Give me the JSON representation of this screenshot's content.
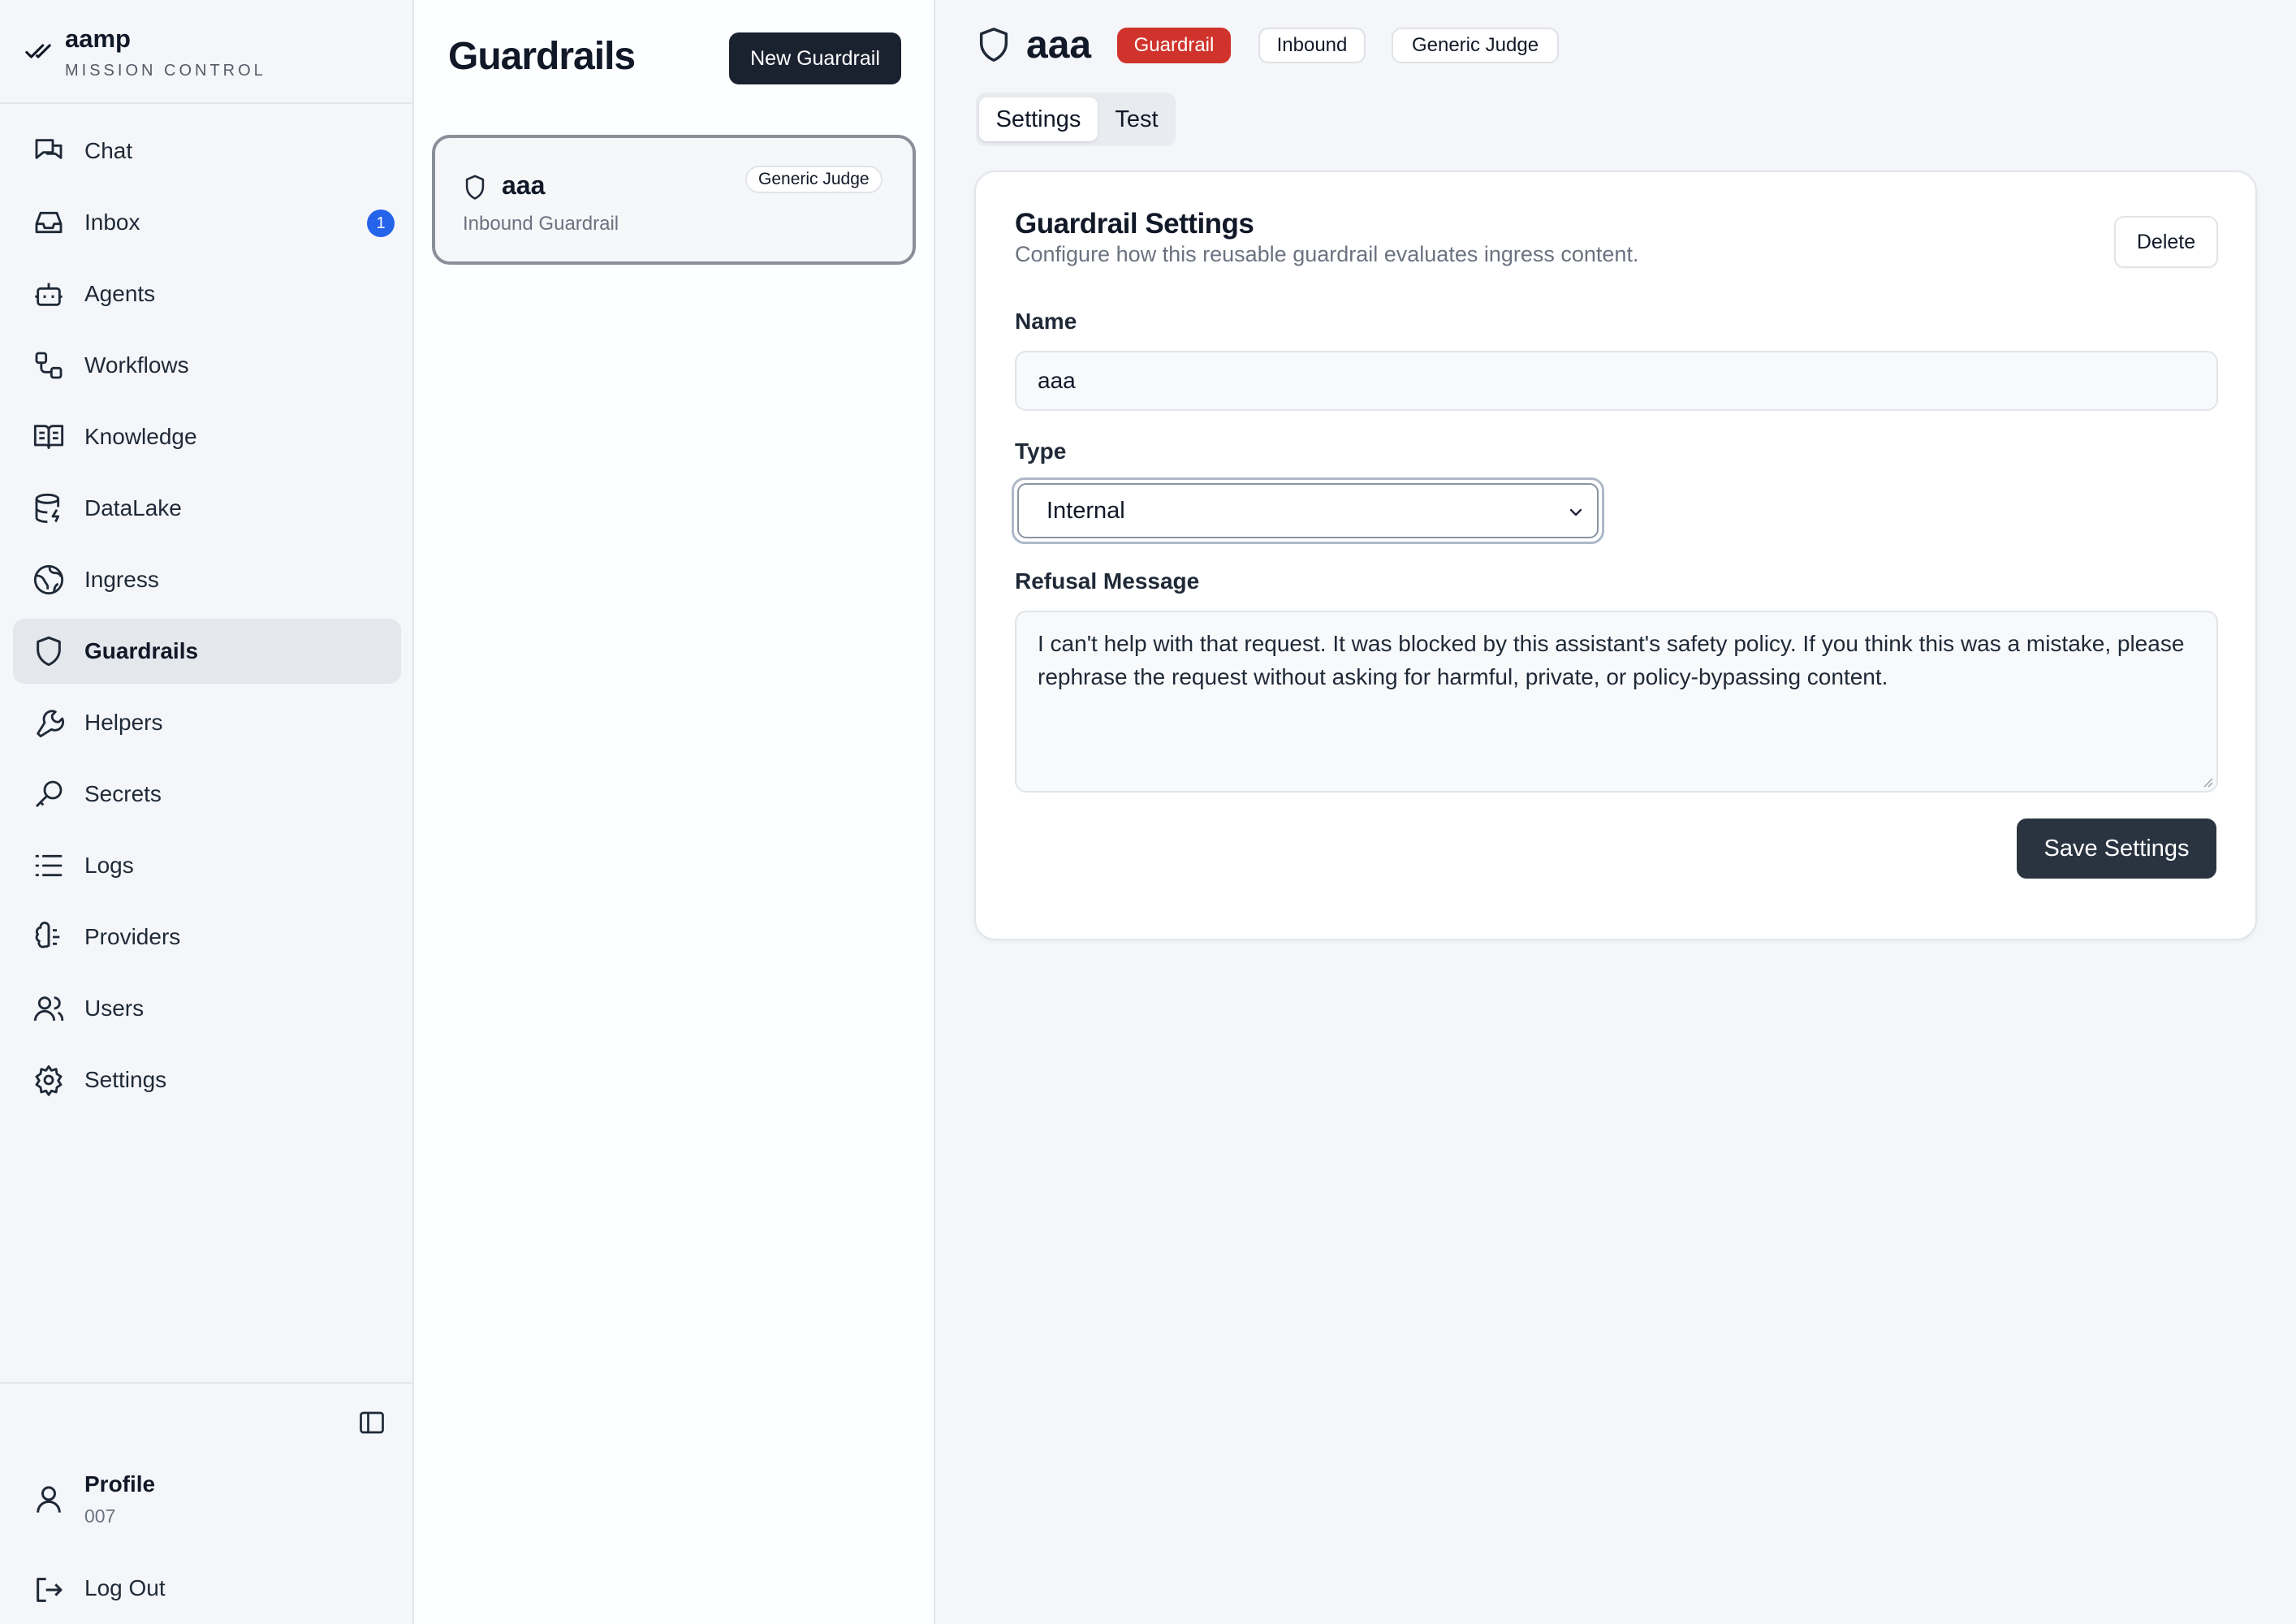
{
  "brand": {
    "name": "aamp",
    "subtitle": "MISSION CONTROL"
  },
  "sidebar": {
    "items": [
      {
        "label": "Chat",
        "icon": "chat-icon"
      },
      {
        "label": "Inbox",
        "icon": "inbox-icon",
        "badge": "1"
      },
      {
        "label": "Agents",
        "icon": "bot-icon"
      },
      {
        "label": "Workflows",
        "icon": "workflow-icon"
      },
      {
        "label": "Knowledge",
        "icon": "book-icon"
      },
      {
        "label": "DataLake",
        "icon": "database-icon"
      },
      {
        "label": "Ingress",
        "icon": "globe-icon"
      },
      {
        "label": "Guardrails",
        "icon": "shield-icon",
        "active": true
      },
      {
        "label": "Helpers",
        "icon": "wrench-icon"
      },
      {
        "label": "Secrets",
        "icon": "key-icon"
      },
      {
        "label": "Logs",
        "icon": "list-icon"
      },
      {
        "label": "Providers",
        "icon": "brain-icon"
      },
      {
        "label": "Users",
        "icon": "users-icon"
      },
      {
        "label": "Settings",
        "icon": "gear-icon"
      }
    ],
    "profile": {
      "label": "Profile",
      "id": "007"
    },
    "logout_label": "Log Out"
  },
  "list": {
    "title": "Guardrails",
    "new_button": "New Guardrail",
    "items": [
      {
        "name": "aaa",
        "subtitle": "Inbound Guardrail",
        "tag": "Generic Judge"
      }
    ]
  },
  "main": {
    "title": "aaa",
    "chips": [
      "Guardrail",
      "Inbound",
      "Generic Judge"
    ],
    "tabs": [
      "Settings",
      "Test"
    ],
    "active_tab": "Settings",
    "panel": {
      "title": "Guardrail Settings",
      "description": "Configure how this reusable guardrail evaluates ingress content.",
      "delete_label": "Delete",
      "name_label": "Name",
      "name_value": "aaa",
      "type_label": "Type",
      "type_value": "Internal",
      "refusal_label": "Refusal Message",
      "refusal_value": "I can't help with that request. It was blocked by this assistant's safety policy. If you think this was a mistake, please rephrase the request without asking for harmful, private, or policy-bypassing content.",
      "save_label": "Save Settings"
    }
  },
  "colors": {
    "accent_red": "#d0332c",
    "dark_button": "#1a2230",
    "badge_blue": "#2563eb"
  }
}
